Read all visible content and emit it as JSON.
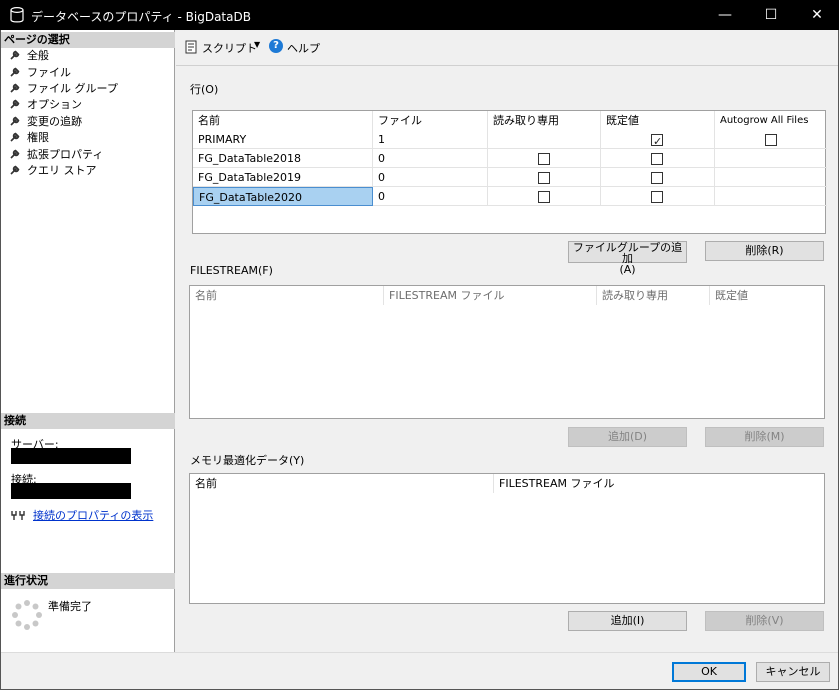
{
  "window": {
    "title": "データベースのプロパティ - BigDataDB",
    "minimize_icon": "minimize-icon",
    "maximize_icon": "maximize-icon",
    "close_icon": "close-icon"
  },
  "sidebar": {
    "page_select_header": "ページの選択",
    "items": [
      {
        "label": "全般"
      },
      {
        "label": "ファイル"
      },
      {
        "label": "ファイル グループ"
      },
      {
        "label": "オプション"
      },
      {
        "label": "変更の追跡"
      },
      {
        "label": "権限"
      },
      {
        "label": "拡張プロパティ"
      },
      {
        "label": "クエリ ストア"
      }
    ],
    "connection_header": "接続",
    "server_label": "サーバー:",
    "connection_label": "接続:",
    "view_connection_link": "接続のプロパティの表示",
    "progress_header": "進行状況",
    "progress_status": "準備完了"
  },
  "toolbar": {
    "script_label": "スクリプト",
    "help_label": "ヘルプ"
  },
  "rows_section": {
    "label": "行(O)",
    "columns": [
      "名前",
      "ファイル",
      "読み取り専用",
      "既定値",
      "Autogrow All Files"
    ],
    "rows": [
      {
        "name": "PRIMARY",
        "files": "1",
        "readonly": null,
        "default": true,
        "autogrow": false
      },
      {
        "name": "FG_DataTable2018",
        "files": "0",
        "readonly": false,
        "default": false,
        "autogrow": null
      },
      {
        "name": "FG_DataTable2019",
        "files": "0",
        "readonly": false,
        "default": false,
        "autogrow": null
      },
      {
        "name": "FG_DataTable2020",
        "files": "0",
        "readonly": false,
        "default": false,
        "autogrow": null
      }
    ],
    "add_button": "ファイルグループの追加(A)",
    "add_button_line1": "ファイルグループの追加",
    "add_button_line2": "(A)",
    "remove_button": "削除(R)"
  },
  "filestream_section": {
    "label": "FILESTREAM(F)",
    "columns": [
      "名前",
      "FILESTREAM ファイル",
      "読み取り専用",
      "既定値"
    ],
    "add_button": "追加(D)",
    "remove_button": "削除(M)"
  },
  "memory_section": {
    "label": "メモリ最適化データ(Y)",
    "columns": [
      "名前",
      "FILESTREAM ファイル"
    ],
    "add_button": "追加(I)",
    "remove_button": "削除(V)"
  },
  "footer": {
    "ok_button": "OK",
    "cancel_button": "キャンセル"
  }
}
